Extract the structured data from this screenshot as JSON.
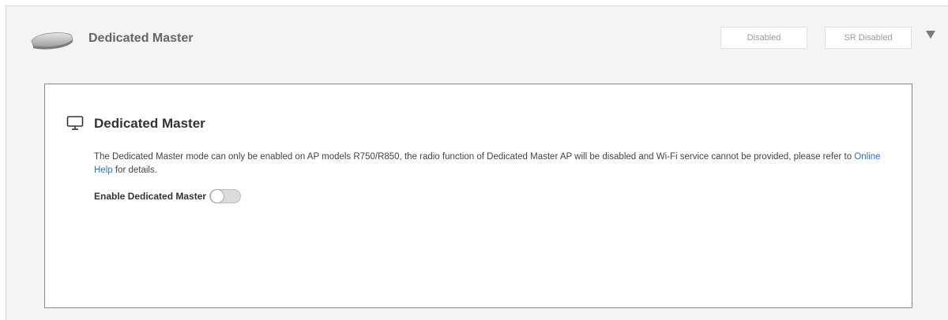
{
  "header": {
    "title": "Dedicated Master",
    "badges": [
      {
        "label": "Disabled"
      },
      {
        "label": "SR Disabled"
      }
    ],
    "expand_icon": "caret-down-icon",
    "device_icon": "access-point-icon"
  },
  "card": {
    "icon": "monitor-icon",
    "title": "Dedicated Master",
    "description_before_link": "The Dedicated Master mode can only be enabled on AP models R750/R850, the radio function of Dedicated Master AP will be disabled and Wi-Fi service cannot be provided, please refer to ",
    "link_text": "Online Help",
    "description_after_link": " for details.",
    "toggle_label": "Enable Dedicated Master",
    "toggle_enabled": false
  },
  "colors": {
    "link": "#2a72c8",
    "panel_bg": "#f4f4f4",
    "card_border": "#8a8a8a"
  }
}
